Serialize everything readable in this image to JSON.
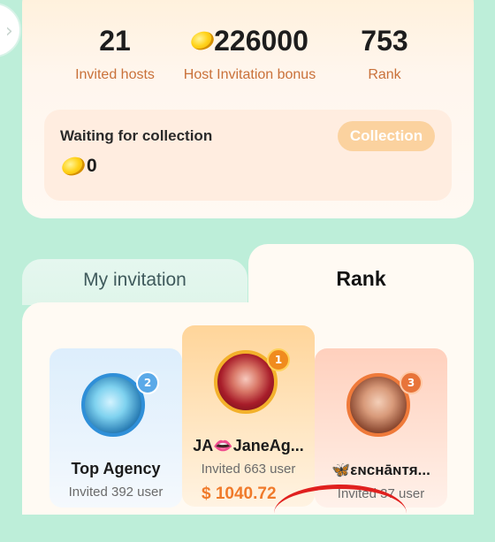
{
  "stats": {
    "invited_hosts": {
      "value": "21",
      "label": "Invited hosts"
    },
    "host_bonus": {
      "value": "226000",
      "label": "Host Invitation bonus"
    },
    "rank": {
      "value": "753",
      "label": "Rank"
    }
  },
  "collection": {
    "title": "Waiting for collection",
    "amount": "0",
    "button_label": "Collection"
  },
  "tabs": [
    {
      "label": "My invitation",
      "active": false
    },
    {
      "label": "Rank",
      "active": true
    }
  ],
  "ranking": [
    {
      "position": "2",
      "name": "Top Agency",
      "invited": "Invited 392 user",
      "amount": ""
    },
    {
      "position": "1",
      "name": "JA👄JaneAg...",
      "invited": "Invited 663 user",
      "amount": "$ 1040.72"
    },
    {
      "position": "3",
      "name": "🦋εɴcнāɴтя...",
      "invited": "Invited 37 user",
      "amount": ""
    }
  ],
  "colors": {
    "background": "#bdeed9",
    "accent_orange": "#c9713a",
    "button": "#fbd29f",
    "gold": "#ffd21a"
  }
}
